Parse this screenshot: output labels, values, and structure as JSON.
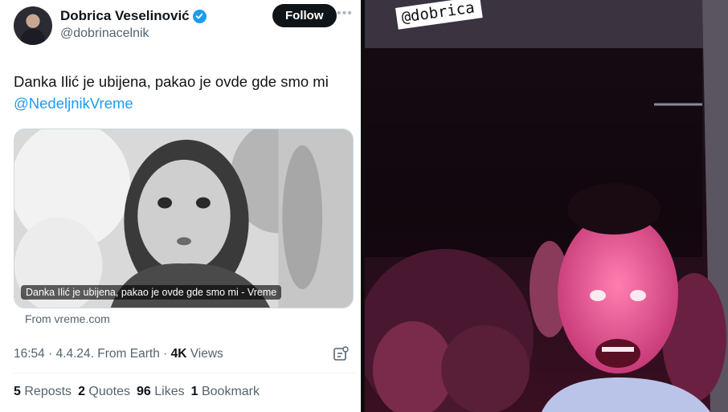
{
  "tweet": {
    "display_name": "Dobrica Veselinović",
    "handle": "@dobrinacelnik",
    "follow_label": "Follow",
    "more_icon": "more-horizontal-icon",
    "text": "Danka Ilić je ubijena, pakao je ovde gde smo mi",
    "mention": "@NedeljnikVreme",
    "card": {
      "caption": "Danka Ilić je ubijena, pakao je ovde gde smo mi - Vreme",
      "source": "From vreme.com"
    },
    "meta": {
      "time": "16:54",
      "date": "4.4.24.",
      "location": "From Earth",
      "views_count": "4K",
      "views_label": "Views"
    },
    "stats": [
      {
        "count": "5",
        "label": "Reposts"
      },
      {
        "count": "2",
        "label": "Quotes"
      },
      {
        "count": "96",
        "label": "Likes"
      },
      {
        "count": "1",
        "label": "Bookmark"
      }
    ],
    "accent_color": "#1d9bf0"
  },
  "story": {
    "mention_sticker": "@dobrica",
    "accent_color": "#e2357f"
  }
}
